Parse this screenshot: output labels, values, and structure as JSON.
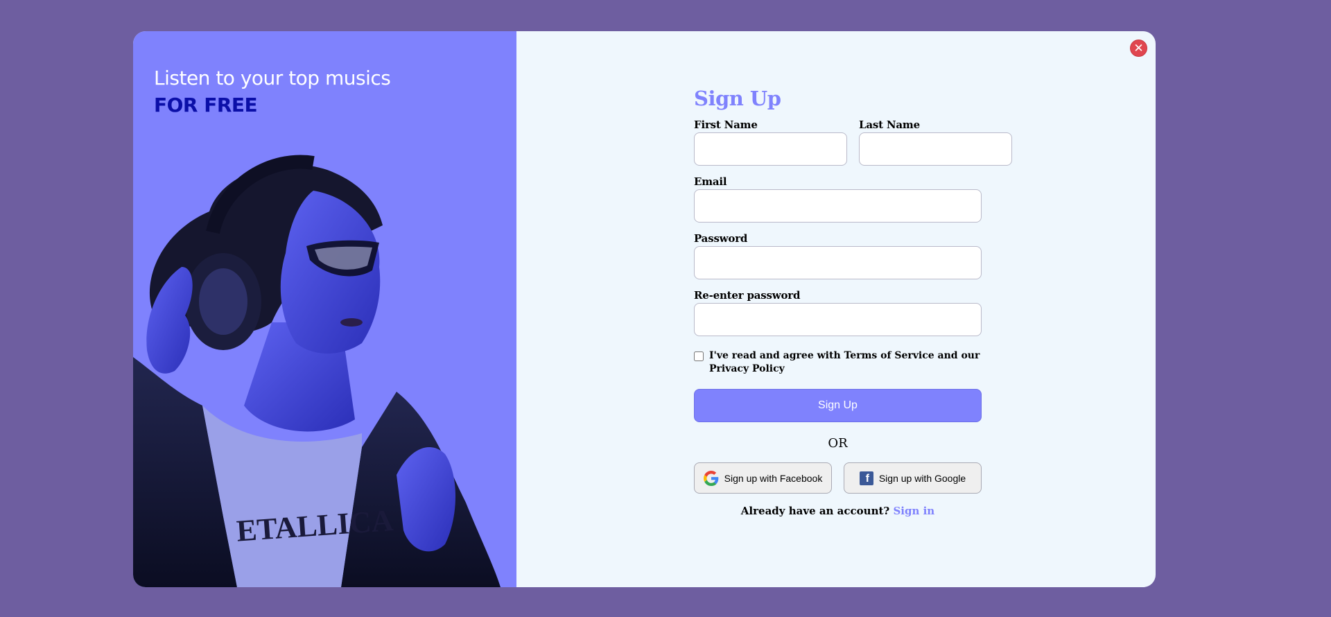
{
  "hero": {
    "headline": "Listen to your top musics",
    "accent": "FOR FREE"
  },
  "close_icon": "close-icon",
  "form": {
    "title": "Sign Up",
    "first_name_label": "First Name",
    "last_name_label": "Last Name",
    "email_label": "Email",
    "password_label": "Password",
    "reenter_label": "Re-enter password",
    "first_name_value": "",
    "last_name_value": "",
    "email_value": "",
    "password_value": "",
    "reenter_value": "",
    "terms_text": "I've read and agree with Terms of Service and our Privacy Policy",
    "terms_checked": false,
    "submit_label": "Sign Up",
    "or_text": "OR",
    "social_left_label": "Sign up with Facebook",
    "social_left_icon": "google-icon",
    "social_right_label": "Sign up with Google",
    "social_right_icon": "facebook-icon",
    "signin_prompt": "Already have an account?",
    "signin_link": "Sign in"
  },
  "colors": {
    "page_bg": "#6e5ea0",
    "accent": "#7f82fd",
    "hero_accent_text": "#0b0fa8",
    "close": "#e0464f",
    "form_bg": "#eff7fd"
  }
}
